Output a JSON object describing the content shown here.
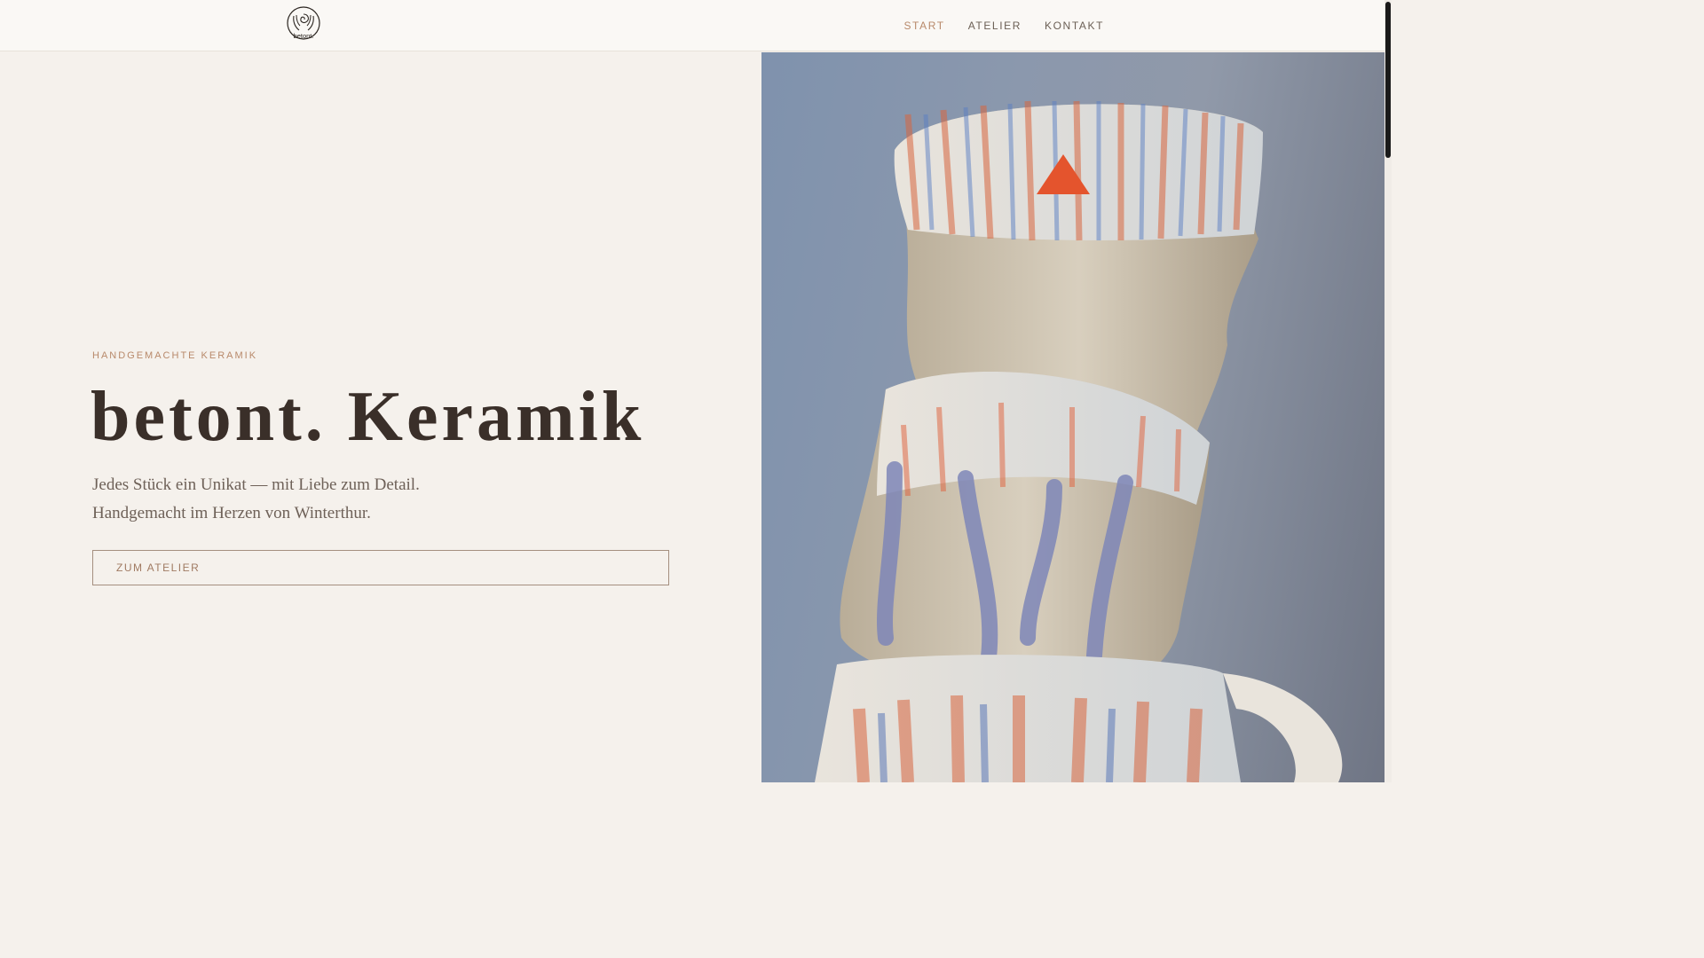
{
  "brand": {
    "logo_text": "betont.",
    "logo_icon": "hands-spiral-icon"
  },
  "nav": {
    "items": [
      {
        "label": "START",
        "active": true
      },
      {
        "label": "ATELIER",
        "active": false
      },
      {
        "label": "KONTAKT",
        "active": false
      }
    ]
  },
  "hero": {
    "eyebrow": "HANDGEMACHTE KERAMIK",
    "title": "betont. Keramik",
    "lead_line1": "Jedes Stück ein Unikat — mit Liebe zum Detail.",
    "lead_line2": "Handgemacht im Herzen von Winterthur.",
    "cta_label": "ZUM ATELIER"
  },
  "colors": {
    "accent": "#b8896a",
    "background": "#f5f1ec",
    "text_dark": "#3a2f29",
    "text_muted": "#6e6158"
  }
}
